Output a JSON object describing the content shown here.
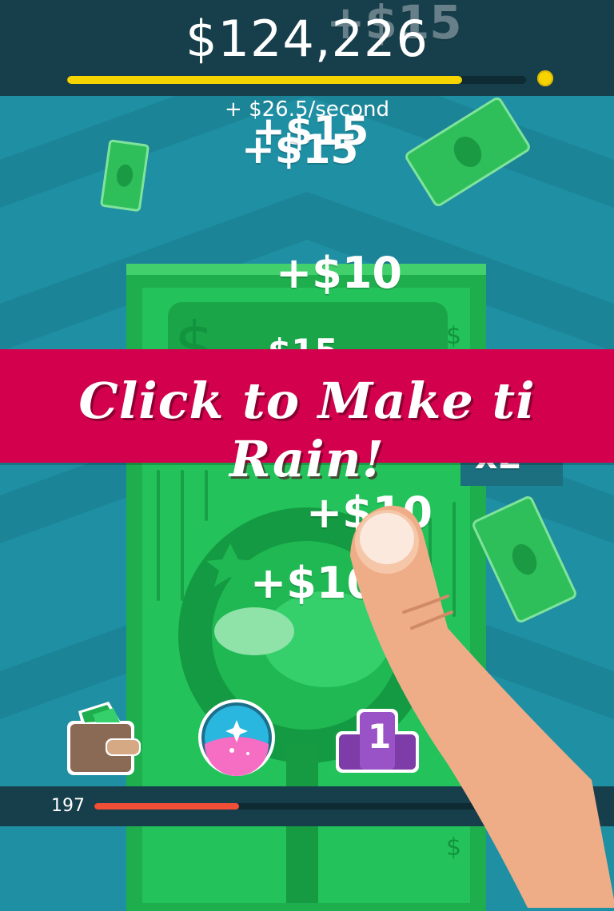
{
  "header": {
    "balance": "$124,226",
    "balance_progress": 0.86,
    "rate": "+ $26.5/second"
  },
  "floating_texts": {
    "f1": "+$15",
    "f2": "+$15",
    "f3": "+$15",
    "f4": "+$10",
    "f5": "$15",
    "f6": "+$10",
    "f7": "+$10",
    "f8": "x2"
  },
  "banner": {
    "text": "Click to Make ti Rain!"
  },
  "toolbar": {
    "wallet_icon": "wallet-icon",
    "bubble_icon": "potion-bubble-icon",
    "leaderboard_icon": "podium-icon",
    "podium_rank": "1"
  },
  "footer": {
    "level": "197",
    "level_progress": 0.37
  },
  "colors": {
    "header_bg": "#173f4b",
    "background": "#1f8fa3",
    "banner": "#d3004d",
    "money_green": "#22c55e",
    "progress_yellow": "#f5d400",
    "progress_red": "#f04e37"
  }
}
